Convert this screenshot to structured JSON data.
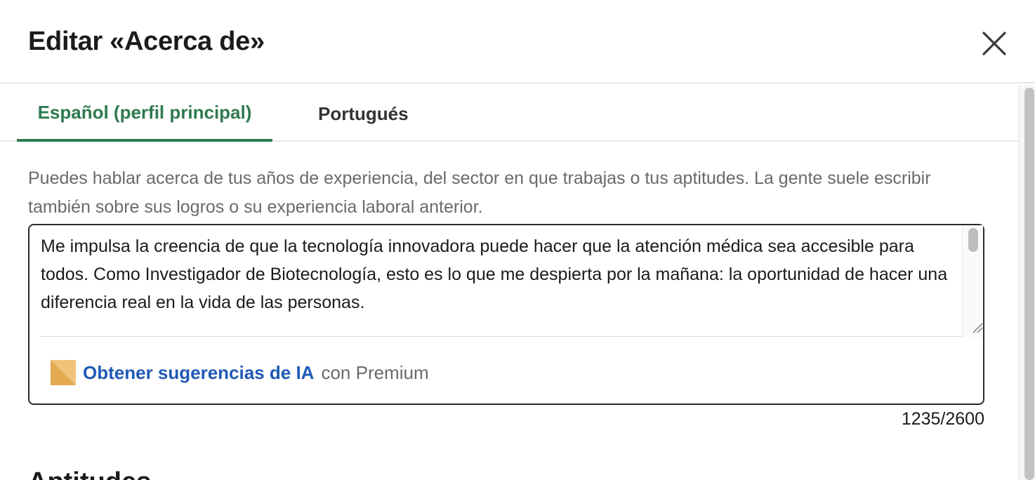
{
  "header": {
    "title": "Editar «Acerca de»",
    "close_icon": "close-icon"
  },
  "tabs": [
    {
      "label": "Español (perfil principal)",
      "active": true
    },
    {
      "label": "Portugués",
      "active": false
    }
  ],
  "helper_text": "Puedes hablar acerca de tus años de experiencia, del sector en que trabajas o tus aptitudes. La gente suele escribir también sobre sus logros o su experiencia laboral anterior.",
  "editor": {
    "value": "Me impulsa la creencia de que la tecnología innovadora puede hacer que la atención médica sea accesible para todos. Como Investigador de Biotecnología, esto es lo que me despierta por la mañana: la oportunidad de hacer una diferencia real en la vida de las personas.",
    "ai_link": "Obtener sugerencias de IA",
    "ai_suffix": "con Premium",
    "ai_icon": "premium-icon"
  },
  "counter": "1235/2600",
  "next_section_heading": "Aptitudes",
  "colors": {
    "accent_green": "#2f7a4f",
    "link_blue": "#1f5ab6",
    "premium_gold": "#e2a94f"
  }
}
